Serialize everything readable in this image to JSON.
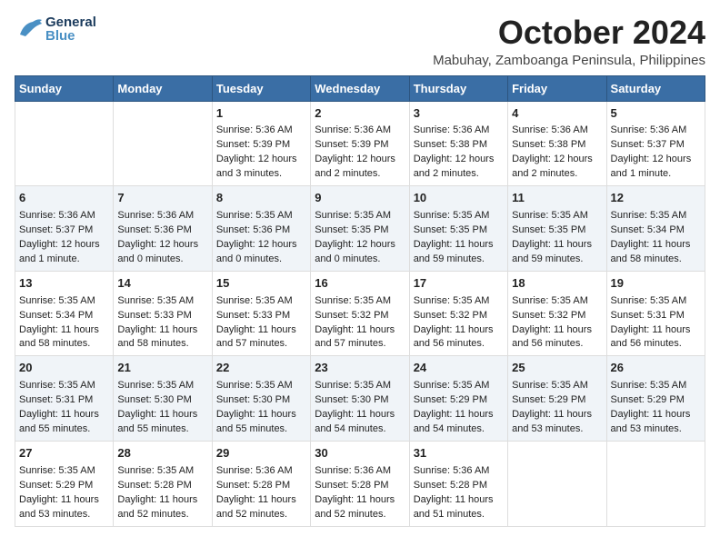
{
  "logo": {
    "general": "General",
    "blue": "Blue"
  },
  "title": "October 2024",
  "location": "Mabuhay, Zamboanga Peninsula, Philippines",
  "columns": [
    "Sunday",
    "Monday",
    "Tuesday",
    "Wednesday",
    "Thursday",
    "Friday",
    "Saturday"
  ],
  "weeks": [
    [
      {
        "day": "",
        "sunrise": "",
        "sunset": "",
        "daylight": ""
      },
      {
        "day": "",
        "sunrise": "",
        "sunset": "",
        "daylight": ""
      },
      {
        "day": "1",
        "sunrise": "Sunrise: 5:36 AM",
        "sunset": "Sunset: 5:39 PM",
        "daylight": "Daylight: 12 hours and 3 minutes."
      },
      {
        "day": "2",
        "sunrise": "Sunrise: 5:36 AM",
        "sunset": "Sunset: 5:39 PM",
        "daylight": "Daylight: 12 hours and 2 minutes."
      },
      {
        "day": "3",
        "sunrise": "Sunrise: 5:36 AM",
        "sunset": "Sunset: 5:38 PM",
        "daylight": "Daylight: 12 hours and 2 minutes."
      },
      {
        "day": "4",
        "sunrise": "Sunrise: 5:36 AM",
        "sunset": "Sunset: 5:38 PM",
        "daylight": "Daylight: 12 hours and 2 minutes."
      },
      {
        "day": "5",
        "sunrise": "Sunrise: 5:36 AM",
        "sunset": "Sunset: 5:37 PM",
        "daylight": "Daylight: 12 hours and 1 minute."
      }
    ],
    [
      {
        "day": "6",
        "sunrise": "Sunrise: 5:36 AM",
        "sunset": "Sunset: 5:37 PM",
        "daylight": "Daylight: 12 hours and 1 minute."
      },
      {
        "day": "7",
        "sunrise": "Sunrise: 5:36 AM",
        "sunset": "Sunset: 5:36 PM",
        "daylight": "Daylight: 12 hours and 0 minutes."
      },
      {
        "day": "8",
        "sunrise": "Sunrise: 5:35 AM",
        "sunset": "Sunset: 5:36 PM",
        "daylight": "Daylight: 12 hours and 0 minutes."
      },
      {
        "day": "9",
        "sunrise": "Sunrise: 5:35 AM",
        "sunset": "Sunset: 5:35 PM",
        "daylight": "Daylight: 12 hours and 0 minutes."
      },
      {
        "day": "10",
        "sunrise": "Sunrise: 5:35 AM",
        "sunset": "Sunset: 5:35 PM",
        "daylight": "Daylight: 11 hours and 59 minutes."
      },
      {
        "day": "11",
        "sunrise": "Sunrise: 5:35 AM",
        "sunset": "Sunset: 5:35 PM",
        "daylight": "Daylight: 11 hours and 59 minutes."
      },
      {
        "day": "12",
        "sunrise": "Sunrise: 5:35 AM",
        "sunset": "Sunset: 5:34 PM",
        "daylight": "Daylight: 11 hours and 58 minutes."
      }
    ],
    [
      {
        "day": "13",
        "sunrise": "Sunrise: 5:35 AM",
        "sunset": "Sunset: 5:34 PM",
        "daylight": "Daylight: 11 hours and 58 minutes."
      },
      {
        "day": "14",
        "sunrise": "Sunrise: 5:35 AM",
        "sunset": "Sunset: 5:33 PM",
        "daylight": "Daylight: 11 hours and 58 minutes."
      },
      {
        "day": "15",
        "sunrise": "Sunrise: 5:35 AM",
        "sunset": "Sunset: 5:33 PM",
        "daylight": "Daylight: 11 hours and 57 minutes."
      },
      {
        "day": "16",
        "sunrise": "Sunrise: 5:35 AM",
        "sunset": "Sunset: 5:32 PM",
        "daylight": "Daylight: 11 hours and 57 minutes."
      },
      {
        "day": "17",
        "sunrise": "Sunrise: 5:35 AM",
        "sunset": "Sunset: 5:32 PM",
        "daylight": "Daylight: 11 hours and 56 minutes."
      },
      {
        "day": "18",
        "sunrise": "Sunrise: 5:35 AM",
        "sunset": "Sunset: 5:32 PM",
        "daylight": "Daylight: 11 hours and 56 minutes."
      },
      {
        "day": "19",
        "sunrise": "Sunrise: 5:35 AM",
        "sunset": "Sunset: 5:31 PM",
        "daylight": "Daylight: 11 hours and 56 minutes."
      }
    ],
    [
      {
        "day": "20",
        "sunrise": "Sunrise: 5:35 AM",
        "sunset": "Sunset: 5:31 PM",
        "daylight": "Daylight: 11 hours and 55 minutes."
      },
      {
        "day": "21",
        "sunrise": "Sunrise: 5:35 AM",
        "sunset": "Sunset: 5:30 PM",
        "daylight": "Daylight: 11 hours and 55 minutes."
      },
      {
        "day": "22",
        "sunrise": "Sunrise: 5:35 AM",
        "sunset": "Sunset: 5:30 PM",
        "daylight": "Daylight: 11 hours and 55 minutes."
      },
      {
        "day": "23",
        "sunrise": "Sunrise: 5:35 AM",
        "sunset": "Sunset: 5:30 PM",
        "daylight": "Daylight: 11 hours and 54 minutes."
      },
      {
        "day": "24",
        "sunrise": "Sunrise: 5:35 AM",
        "sunset": "Sunset: 5:29 PM",
        "daylight": "Daylight: 11 hours and 54 minutes."
      },
      {
        "day": "25",
        "sunrise": "Sunrise: 5:35 AM",
        "sunset": "Sunset: 5:29 PM",
        "daylight": "Daylight: 11 hours and 53 minutes."
      },
      {
        "day": "26",
        "sunrise": "Sunrise: 5:35 AM",
        "sunset": "Sunset: 5:29 PM",
        "daylight": "Daylight: 11 hours and 53 minutes."
      }
    ],
    [
      {
        "day": "27",
        "sunrise": "Sunrise: 5:35 AM",
        "sunset": "Sunset: 5:29 PM",
        "daylight": "Daylight: 11 hours and 53 minutes."
      },
      {
        "day": "28",
        "sunrise": "Sunrise: 5:35 AM",
        "sunset": "Sunset: 5:28 PM",
        "daylight": "Daylight: 11 hours and 52 minutes."
      },
      {
        "day": "29",
        "sunrise": "Sunrise: 5:36 AM",
        "sunset": "Sunset: 5:28 PM",
        "daylight": "Daylight: 11 hours and 52 minutes."
      },
      {
        "day": "30",
        "sunrise": "Sunrise: 5:36 AM",
        "sunset": "Sunset: 5:28 PM",
        "daylight": "Daylight: 11 hours and 52 minutes."
      },
      {
        "day": "31",
        "sunrise": "Sunrise: 5:36 AM",
        "sunset": "Sunset: 5:28 PM",
        "daylight": "Daylight: 11 hours and 51 minutes."
      },
      {
        "day": "",
        "sunrise": "",
        "sunset": "",
        "daylight": ""
      },
      {
        "day": "",
        "sunrise": "",
        "sunset": "",
        "daylight": ""
      }
    ]
  ]
}
